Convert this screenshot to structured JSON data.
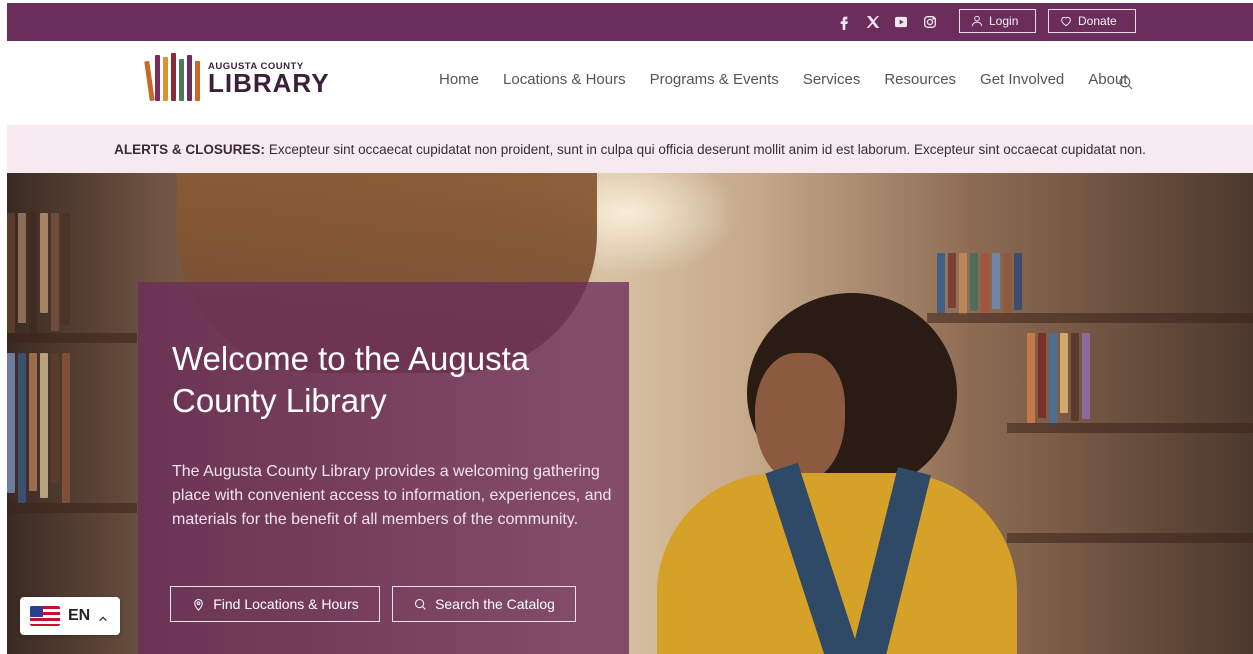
{
  "colors": {
    "brand_purple": "#6b2d5b",
    "alert_bg": "#f6eaf0",
    "white": "#ffffff"
  },
  "topbar": {
    "social_icons": [
      "facebook-icon",
      "x-icon",
      "youtube-icon",
      "instagram-icon"
    ],
    "login_label": "Login",
    "donate_label": "Donate"
  },
  "logo": {
    "small_text": "AUGUSTA COUNTY",
    "big_text": "LIBRARY"
  },
  "nav": {
    "items": [
      "Home",
      "Locations & Hours",
      "Programs & Events",
      "Services",
      "Resources",
      "Get Involved",
      "About"
    ],
    "search_icon": "search-icon"
  },
  "alert": {
    "label": "ALERTS & CLOSURES:",
    "text": "Excepteur sint occaecat cupidatat non proident, sunt in culpa qui officia deserunt mollit anim id est laborum. Excepteur sint occaecat cupidatat non."
  },
  "hero": {
    "title": "Welcome to the Augusta County Library",
    "description": "The Augusta County Library provides a welcoming gathering place with convenient access to information, experiences, and materials for the benefit of all members of the community.",
    "btn_locations": "Find Locations & Hours",
    "btn_catalog": "Search the Catalog"
  },
  "language": {
    "code": "EN"
  }
}
